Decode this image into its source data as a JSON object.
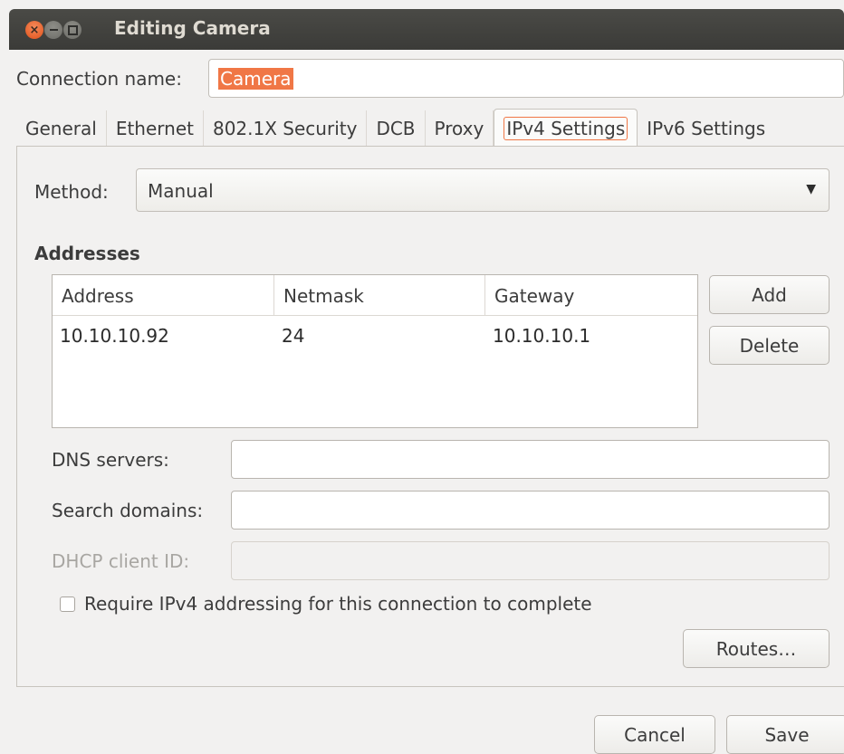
{
  "window": {
    "title": "Editing Camera"
  },
  "connection": {
    "label": "Connection name:",
    "value": "Camera"
  },
  "tabs": [
    {
      "label": "General",
      "active": false
    },
    {
      "label": "Ethernet",
      "active": false
    },
    {
      "label": "802.1X Security",
      "active": false
    },
    {
      "label": "DCB",
      "active": false
    },
    {
      "label": "Proxy",
      "active": false
    },
    {
      "label": "IPv4 Settings",
      "active": true
    },
    {
      "label": "IPv6 Settings",
      "active": false
    }
  ],
  "method": {
    "label": "Method:",
    "value": "Manual"
  },
  "addresses": {
    "heading": "Addresses",
    "columns": [
      "Address",
      "Netmask",
      "Gateway"
    ],
    "rows": [
      [
        "10.10.10.92",
        "24",
        "10.10.10.1"
      ]
    ],
    "add_label": "Add",
    "delete_label": "Delete"
  },
  "fields": {
    "dns_label": "DNS servers:",
    "dns_value": "",
    "search_label": "Search domains:",
    "search_value": "",
    "dhcp_label": "DHCP client ID:",
    "dhcp_value": ""
  },
  "require_ipv4": {
    "label": "Require IPv4 addressing for this connection to complete",
    "checked": false
  },
  "buttons": {
    "routes": "Routes…",
    "cancel": "Cancel",
    "save": "Save"
  },
  "colors": {
    "accent": "#f07746",
    "titlebar": "#3c3b37"
  }
}
